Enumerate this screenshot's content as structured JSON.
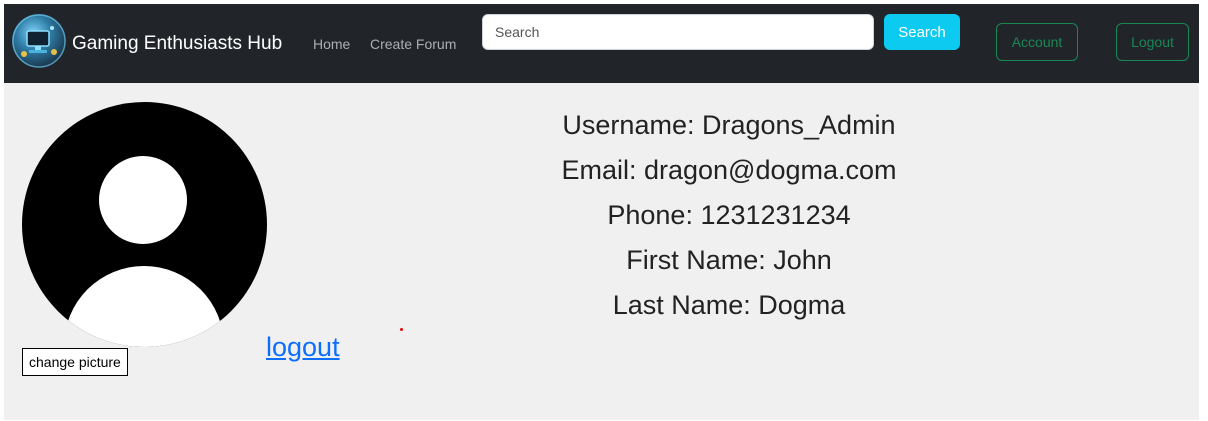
{
  "navbar": {
    "logo_icon": "gaming-logo-icon",
    "brand": "Gaming Enthusiasts Hub",
    "links": [
      {
        "label": "Home"
      },
      {
        "label": "Create Forum"
      }
    ],
    "search": {
      "placeholder": "Search",
      "value": "",
      "button_label": "Search"
    },
    "account_label": "Account",
    "logout_label": "Logout",
    "colors": {
      "background": "#212529",
      "search_button": "#0dcaf0",
      "outline_buttons": "#198754"
    }
  },
  "profile": {
    "avatar_icon": "default-user-avatar-icon",
    "change_picture_label": "change picture",
    "logout_link": "logout",
    "lines": [
      "Username: Dragons_Admin",
      "Email: dragon@dogma.com",
      "Phone: 1231231234",
      "First Name: John",
      "Last Name: Dogma"
    ]
  }
}
